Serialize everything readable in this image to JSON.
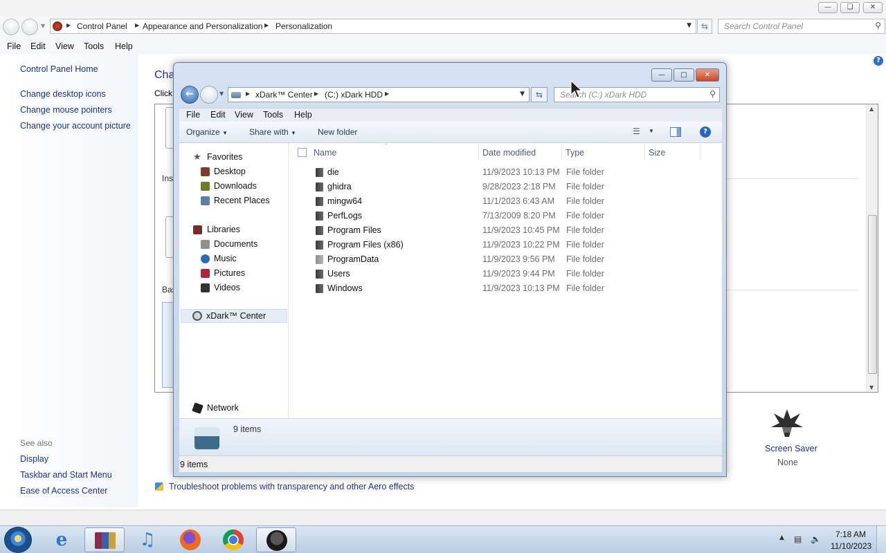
{
  "control_panel": {
    "breadcrumb": [
      "Control Panel",
      "Appearance and Personalization",
      "Personalization"
    ],
    "search_placeholder": "Search Control Panel",
    "menu": [
      "File",
      "Edit",
      "View",
      "Tools",
      "Help"
    ],
    "left_links": [
      "Control Panel Home",
      "Change desktop icons",
      "Change mouse pointers",
      "Change your account picture"
    ],
    "see_also_label": "See also",
    "see_also_links": [
      "Display",
      "Taskbar and Start Menu",
      "Ease of Access Center"
    ],
    "heading_fragment": "Cha",
    "subtext_fragment": "Click",
    "section_fragments": [
      "Inst",
      "Bas"
    ],
    "screen_saver": {
      "label": "Screen Saver",
      "value": "None"
    },
    "troubleshoot_link": "Troubleshoot problems with transparency and other Aero effects"
  },
  "explorer": {
    "breadcrumb": [
      "xDark™ Center",
      "(C:) xDark HDD"
    ],
    "search_placeholder": "Search (C:) xDark HDD",
    "menu": [
      "File",
      "Edit",
      "View",
      "Tools",
      "Help"
    ],
    "toolbar": {
      "organize": "Organize",
      "share_with": "Share with",
      "new_folder": "New folder"
    },
    "nav": {
      "favorites_label": "Favorites",
      "favorites": [
        "Desktop",
        "Downloads",
        "Recent Places"
      ],
      "libraries_label": "Libraries",
      "libraries": [
        "Documents",
        "Music",
        "Pictures",
        "Videos"
      ],
      "computer": "xDark™ Center",
      "network": "Network"
    },
    "columns": {
      "name": "Name",
      "date": "Date modified",
      "type": "Type",
      "size": "Size"
    },
    "files": [
      {
        "name": "die",
        "date": "11/9/2023 10:13 PM",
        "type": "File folder"
      },
      {
        "name": "ghidra",
        "date": "9/28/2023 2:18 PM",
        "type": "File folder"
      },
      {
        "name": "mingw64",
        "date": "11/1/2023 6:43 AM",
        "type": "File folder"
      },
      {
        "name": "PerfLogs",
        "date": "7/13/2009 8:20 PM",
        "type": "File folder"
      },
      {
        "name": "Program Files",
        "date": "11/9/2023 10:45 PM",
        "type": "File folder"
      },
      {
        "name": "Program Files (x86)",
        "date": "11/9/2023 10:22 PM",
        "type": "File folder"
      },
      {
        "name": "ProgramData",
        "date": "11/9/2023 9:56 PM",
        "type": "File folder"
      },
      {
        "name": "Users",
        "date": "11/9/2023 9:44 PM",
        "type": "File folder"
      },
      {
        "name": "Windows",
        "date": "11/9/2023 10:13 PM",
        "type": "File folder"
      }
    ],
    "details_count": "9 items",
    "status_text": "9 items"
  },
  "taskbar": {
    "time": "7:18 AM",
    "date": "11/10/2023"
  },
  "icons": {
    "control_panel_app": "control-panel-icon",
    "drive": "hard-drive-icon",
    "folder": "folder-icon",
    "star": "star-icon",
    "network": "network-icon"
  },
  "colors": {
    "link_blue": "#1e3287",
    "explorer_frame": "#c3d4ea",
    "close_red": "#c9462a"
  }
}
